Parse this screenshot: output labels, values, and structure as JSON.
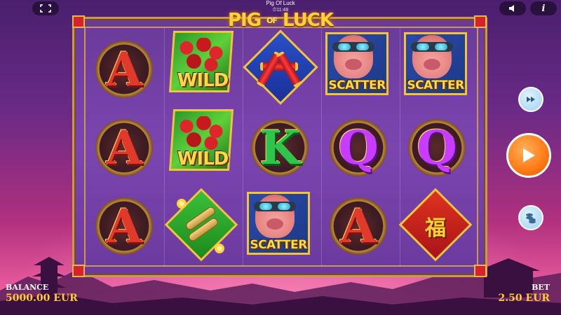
{
  "header": {
    "title": "Pig Of Luck",
    "clock": "⏱11:48",
    "fullscreen_icon": "fullscreen-icon",
    "sound_icon": "speaker-icon",
    "info_label": "i"
  },
  "logo": {
    "word1": "PIG",
    "word2": "OF",
    "word3": "LUCK"
  },
  "reels": [
    [
      "A",
      "A",
      "A"
    ],
    [
      "WILD",
      "WILD",
      "scroll"
    ],
    [
      "firecracker",
      "K",
      "SCATTER"
    ],
    [
      "SCATTER",
      "Q",
      "A"
    ],
    [
      "SCATTER",
      "Q",
      "fortune-character"
    ]
  ],
  "symbols": {
    "wild_label": "WILD",
    "scatter_label": "SCATTER",
    "letter_a": "A",
    "letter_k": "K",
    "letter_q": "Q",
    "fortune_char": "福"
  },
  "controls": {
    "turbo_icon": "fast-forward-icon",
    "spin_icon": "play-icon",
    "bet_icon": "coin-stack-icon"
  },
  "footer": {
    "balance_label": "BALANCE",
    "balance_value": "5000.00 EUR",
    "bet_label": "BET",
    "bet_value": "2.50 EUR"
  },
  "colors": {
    "frame_gold": "#c99a4a",
    "accent_orange": "#ff7a14",
    "amount_yellow": "#ffcc33"
  }
}
